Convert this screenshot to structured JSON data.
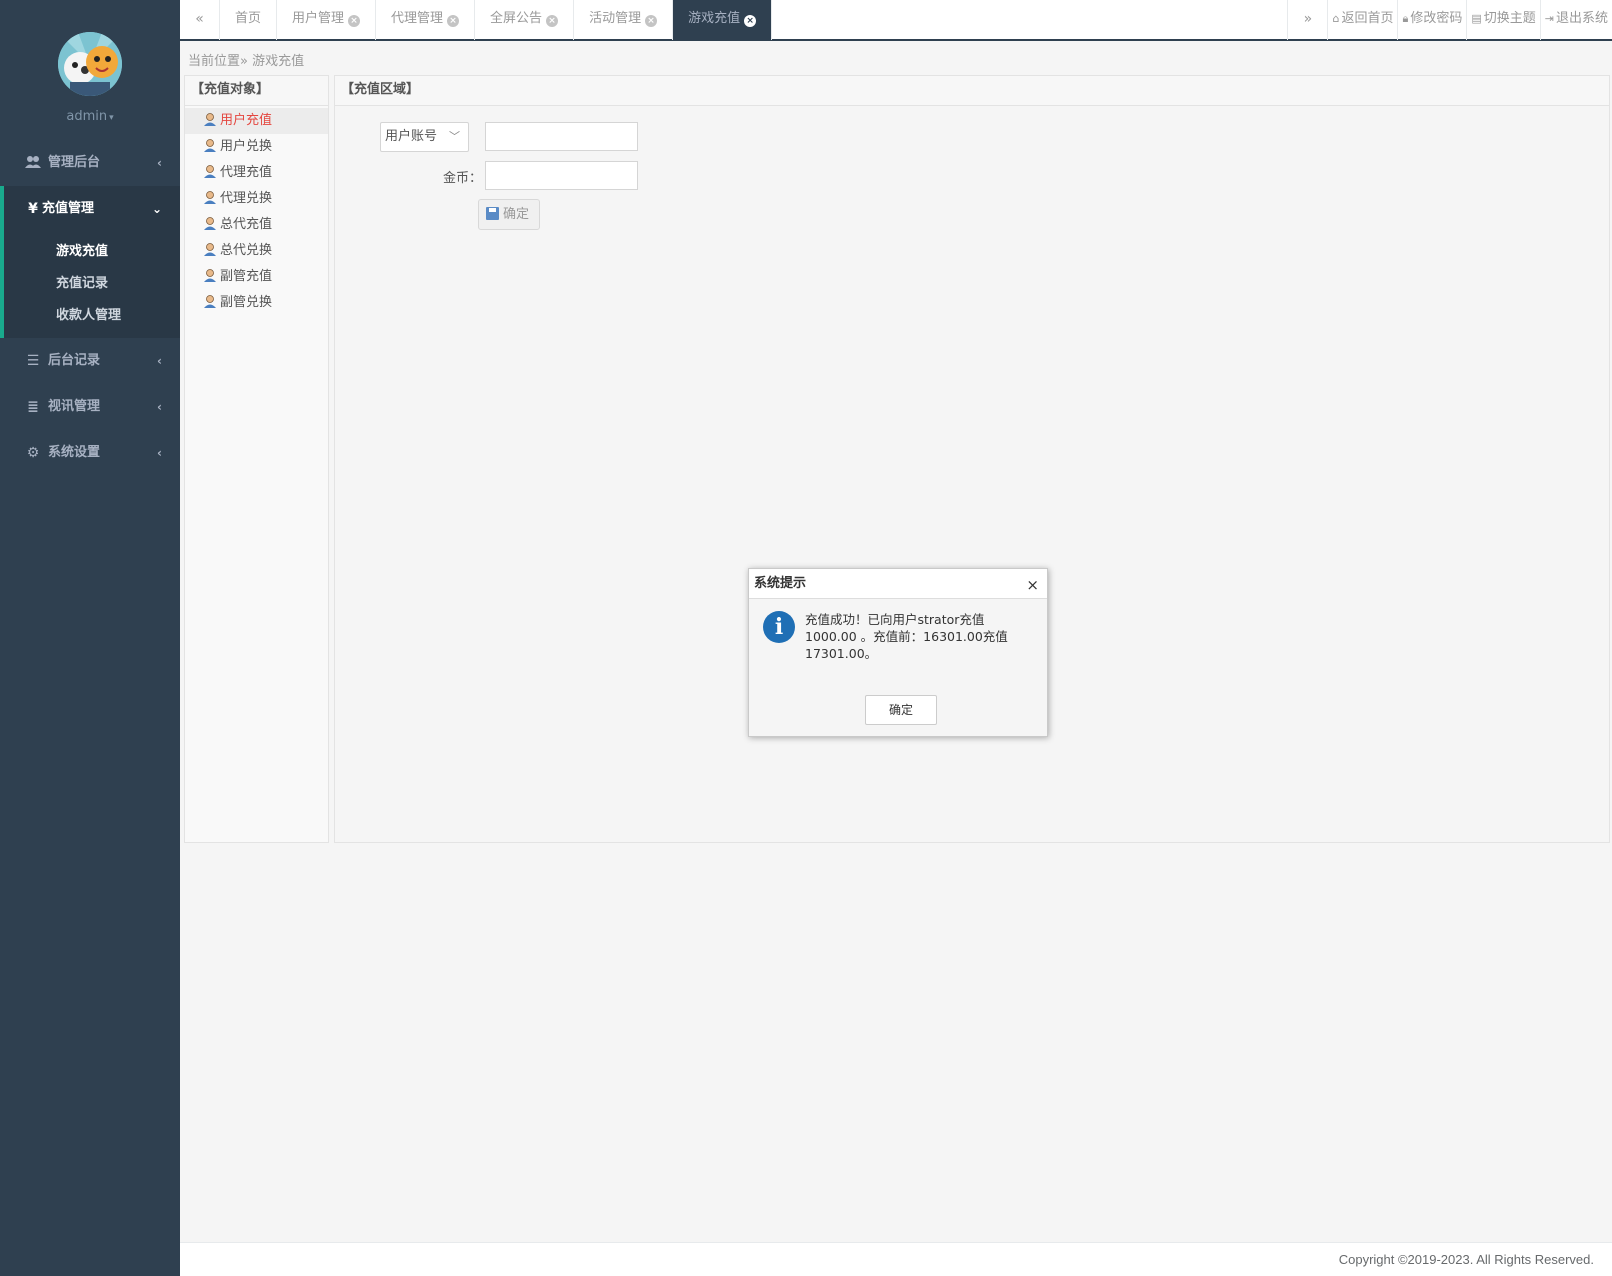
{
  "sidebar": {
    "username": "admin",
    "nav": [
      {
        "label": "管理后台",
        "icon": "users-icon",
        "expanded": false
      },
      {
        "label": "充值管理",
        "icon": "yen-icon",
        "expanded": true,
        "children": [
          "游戏充值",
          "充值记录",
          "收款人管理"
        ]
      },
      {
        "label": "后台记录",
        "icon": "list-icon",
        "expanded": false
      },
      {
        "label": "视讯管理",
        "icon": "indent-icon",
        "expanded": false
      },
      {
        "label": "系统设置",
        "icon": "gears-icon",
        "expanded": false
      }
    ]
  },
  "topbar": {
    "prev_glyph": "«",
    "next_glyph": "»",
    "tabs": [
      {
        "label": "首页",
        "closable": false
      },
      {
        "label": "用户管理",
        "closable": true
      },
      {
        "label": "代理管理",
        "closable": true
      },
      {
        "label": "全屏公告",
        "closable": true
      },
      {
        "label": "活动管理",
        "closable": true
      },
      {
        "label": "游戏充值",
        "closable": true,
        "active": true
      }
    ],
    "actions": {
      "home": "返回首页",
      "password": "修改密码",
      "theme": "切换主题",
      "logout": "退出系统"
    }
  },
  "breadcrumb": {
    "prefix": "当前位置»",
    "current": "游戏充值"
  },
  "objects_panel": {
    "title": "【充值对象】",
    "items": [
      "用户充值",
      "用户兑换",
      "代理充值",
      "代理兑换",
      "总代充值",
      "总代兑换",
      "副管充值",
      "副管兑换"
    ],
    "active_index": 0
  },
  "recharge_panel": {
    "title": "【充值区域】",
    "account_type": "用户账号",
    "account_value": "",
    "gold_label": "金币：",
    "gold_value": "",
    "submit_label": "确定"
  },
  "dialog": {
    "title": "系统提示",
    "close_glyph": "×",
    "message": "充值成功！已向用户strator充值 1000.00 。充值前：16301.00充值 17301.00。",
    "ok_label": "确定"
  },
  "footer": {
    "copyright": "Copyright ©2019-2023. All Rights Reserved."
  },
  "colors": {
    "sidebar_bg": "#2f4050",
    "accent": "#19aa8d",
    "active_object": "#e4463f",
    "info_icon": "#1f6fb5"
  }
}
